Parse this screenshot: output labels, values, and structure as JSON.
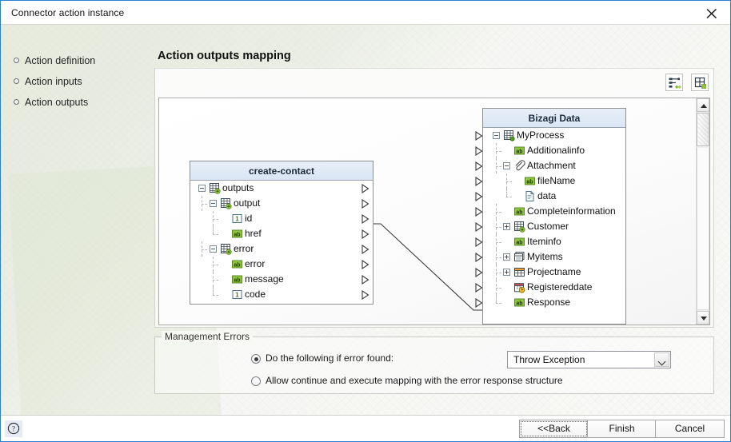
{
  "window": {
    "title": "Connector action instance",
    "close_icon": "close-icon",
    "accent": "#2a7fd4"
  },
  "sidebar": {
    "items": [
      {
        "label": "Action definition"
      },
      {
        "label": "Action inputs"
      },
      {
        "label": "Action outputs"
      }
    ]
  },
  "main": {
    "page_title": "Action outputs mapping",
    "toolbar": [
      {
        "name": "auto-map-icon",
        "title": "Auto map"
      },
      {
        "name": "layout-icon",
        "title": "Layout"
      }
    ]
  },
  "source_tree": {
    "header": "create-contact",
    "rows": [
      {
        "label": "outputs",
        "depth": 0,
        "icon": "collection-icon",
        "toggle": "minus"
      },
      {
        "label": "output",
        "depth": 1,
        "icon": "collection-icon",
        "toggle": "minus"
      },
      {
        "label": "id",
        "depth": 2,
        "icon": "number-icon",
        "toggle": "none"
      },
      {
        "label": "href",
        "depth": 2,
        "icon": "string-icon",
        "toggle": "none"
      },
      {
        "label": "error",
        "depth": 1,
        "icon": "collection-icon",
        "toggle": "minus"
      },
      {
        "label": "error",
        "depth": 2,
        "icon": "string-icon",
        "toggle": "none"
      },
      {
        "label": "message",
        "depth": 2,
        "icon": "string-icon",
        "toggle": "none"
      },
      {
        "label": "code",
        "depth": 2,
        "icon": "number-icon",
        "toggle": "none"
      }
    ]
  },
  "target_tree": {
    "header": "Bizagi Data",
    "rows": [
      {
        "label": "MyProcess",
        "depth": 0,
        "icon": "process-icon",
        "toggle": "minus"
      },
      {
        "label": "Additionalinfo",
        "depth": 1,
        "icon": "string-icon",
        "toggle": "none"
      },
      {
        "label": "Attachment",
        "depth": 1,
        "icon": "attachment-icon",
        "toggle": "minus"
      },
      {
        "label": "fileName",
        "depth": 2,
        "icon": "string-icon",
        "toggle": "none"
      },
      {
        "label": "data",
        "depth": 2,
        "icon": "file-icon",
        "toggle": "none"
      },
      {
        "label": "Completeinformation",
        "depth": 1,
        "icon": "string-icon",
        "toggle": "none"
      },
      {
        "label": "Customer",
        "depth": 1,
        "icon": "collection-icon",
        "toggle": "plus"
      },
      {
        "label": "Iteminfo",
        "depth": 1,
        "icon": "string-icon",
        "toggle": "none"
      },
      {
        "label": "Myitems",
        "depth": 1,
        "icon": "list-icon",
        "toggle": "plus"
      },
      {
        "label": "Projectname",
        "depth": 1,
        "icon": "table-icon",
        "toggle": "plus"
      },
      {
        "label": "Registereddate",
        "depth": 1,
        "icon": "date-icon",
        "toggle": "none"
      },
      {
        "label": "Response",
        "depth": 1,
        "icon": "string-icon",
        "toggle": "none"
      }
    ]
  },
  "mapping_links": [
    {
      "from": "id",
      "to": "Response"
    }
  ],
  "management_errors": {
    "legend": "Management Errors",
    "option_error_found": {
      "label": "Do the following if error found:",
      "selected": true
    },
    "option_continue": {
      "label": "Allow continue and execute mapping with the error response structure",
      "selected": false
    },
    "error_action_select": {
      "value": "Throw Exception",
      "options": [
        "Throw Exception"
      ]
    }
  },
  "scrollbar": {
    "up_icon": "chevron-up-icon",
    "down_icon": "chevron-down-icon"
  },
  "footer": {
    "help_icon": "help-icon",
    "buttons": [
      {
        "label": "<<Back",
        "name": "back-button",
        "focused": true
      },
      {
        "label": "Finish",
        "name": "finish-button",
        "focused": false
      },
      {
        "label": "Cancel",
        "name": "cancel-button",
        "focused": false
      }
    ]
  }
}
